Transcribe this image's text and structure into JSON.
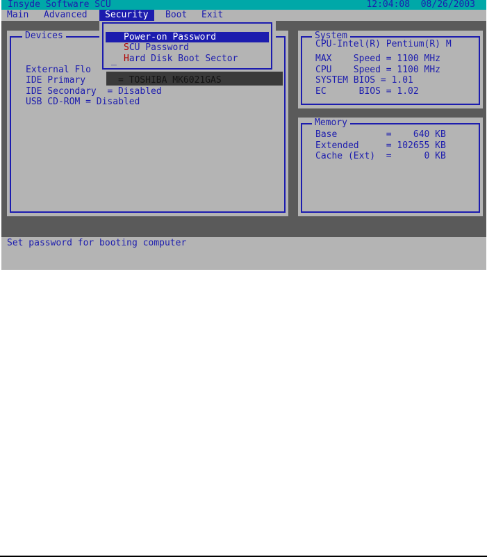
{
  "title_bar": {
    "title": "Insyde Software SCU",
    "time": "12:04:08",
    "date": "08/26/2003"
  },
  "menu": {
    "items": [
      {
        "label": "Main"
      },
      {
        "label": "Advanced"
      },
      {
        "label": "Security"
      },
      {
        "label": "Boot"
      },
      {
        "label": "Exit"
      }
    ],
    "active": "Security"
  },
  "security_dropdown": {
    "items": [
      {
        "hotkey": "P",
        "rest": "ower-on Password"
      },
      {
        "hotkey": "S",
        "rest": "CU Password"
      },
      {
        "hotkey": "H",
        "rest": "ard Disk Boot Sector"
      }
    ],
    "selected": "Power-on Password"
  },
  "devices_panel": {
    "title": "Devices",
    "rows": [
      {
        "label": "External Flo"
      },
      {
        "label": "IDE Primary"
      },
      {
        "label": "IDE Secondary",
        "value": "= Disabled"
      },
      {
        "label": "USB CD-ROM",
        "value": "= Disabled"
      }
    ],
    "ide_primary_value": "= TOSHIBA MK6021GAS"
  },
  "system_panel": {
    "title": "System",
    "rows": [
      {
        "text": "CPU-Intel(R) Pentium(R) M"
      },
      {
        "text": "MAX    Speed = 1100 MHz"
      },
      {
        "text": "CPU    Speed = 1100 MHz"
      },
      {
        "text": "SYSTEM BIOS = 1.01"
      },
      {
        "text": "EC      BIOS = 1.02"
      }
    ]
  },
  "memory_panel": {
    "title": "Memory",
    "rows": [
      {
        "text": "Base         =    640 KB"
      },
      {
        "text": "Extended     = 102655 KB"
      },
      {
        "text": "Cache (Ext)  =      0 KB"
      }
    ]
  },
  "status": {
    "help_text": "Set password for booting computer"
  },
  "colors": {
    "bios_blue": "#1c1cae",
    "title_teal": "#00a8a8",
    "panel_gray": "#b4b4b4",
    "background_dark": "#5a5a5a",
    "hotkey_red": "#b00000"
  }
}
